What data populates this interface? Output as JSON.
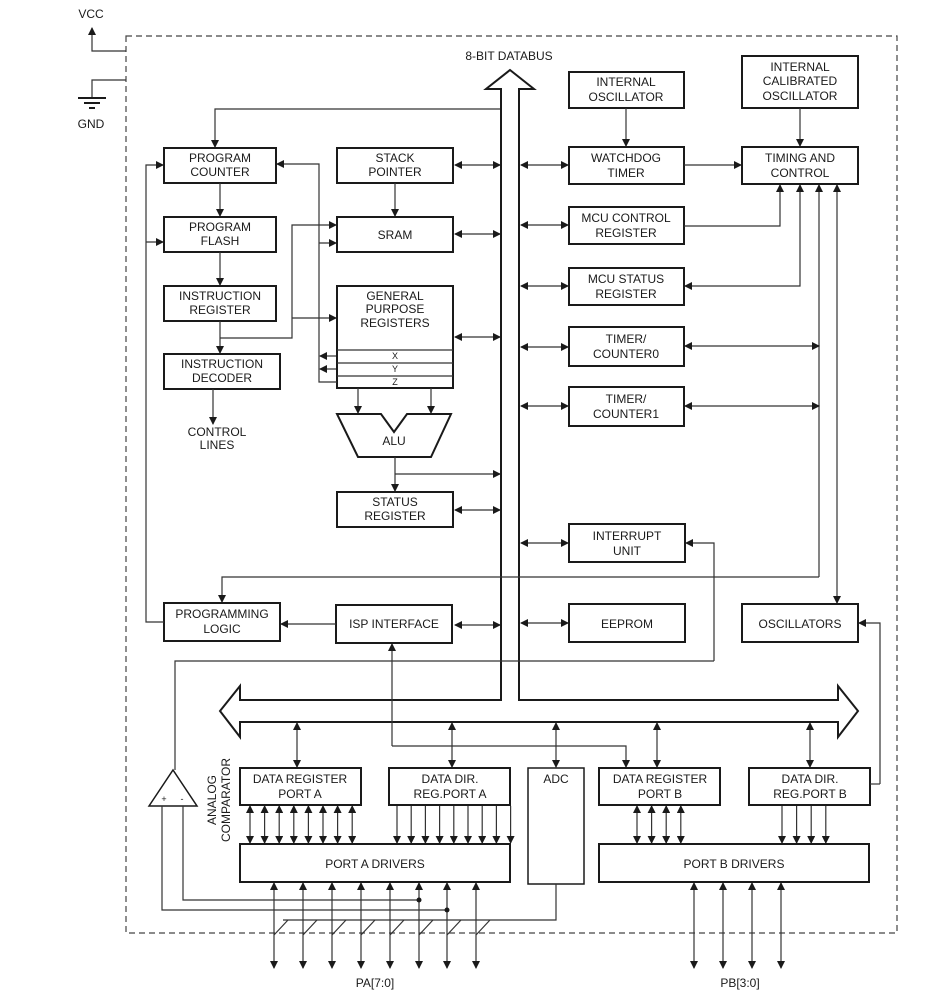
{
  "power": {
    "vcc": "VCC",
    "gnd": "GND"
  },
  "databus": {
    "label": "8-BIT DATABUS"
  },
  "blocks": {
    "program_counter": [
      "PROGRAM",
      "COUNTER"
    ],
    "program_flash": [
      "PROGRAM",
      "FLASH"
    ],
    "instruction_register": [
      "INSTRUCTION",
      "REGISTER"
    ],
    "instruction_decoder": [
      "INSTRUCTION",
      "DECODER"
    ],
    "control_lines": [
      "CONTROL",
      "LINES"
    ],
    "stack_pointer": [
      "STACK",
      "POINTER"
    ],
    "sram": [
      "SRAM"
    ],
    "gpr": [
      "GENERAL",
      "PURPOSE",
      "REGISTERS"
    ],
    "gpr_x": "X",
    "gpr_y": "Y",
    "gpr_z": "Z",
    "alu": "ALU",
    "status_register": [
      "STATUS",
      "REGISTER"
    ],
    "programming_logic": [
      "PROGRAMMING",
      "LOGIC"
    ],
    "isp_interface": [
      "ISP INTERFACE"
    ],
    "internal_oscillator": [
      "INTERNAL",
      "OSCILLATOR"
    ],
    "internal_calibrated_oscillator": [
      "INTERNAL",
      "CALIBRATED",
      "OSCILLATOR"
    ],
    "watchdog_timer": [
      "WATCHDOG",
      "TIMER"
    ],
    "timing_control": [
      "TIMING AND",
      "CONTROL"
    ],
    "mcu_control_register": [
      "MCU CONTROL",
      "REGISTER"
    ],
    "mcu_status_register": [
      "MCU STATUS",
      "REGISTER"
    ],
    "timer_counter0": [
      "TIMER/",
      "COUNTER0"
    ],
    "timer_counter1": [
      "TIMER/",
      "COUNTER1"
    ],
    "interrupt_unit": [
      "INTERRUPT",
      "UNIT"
    ],
    "eeprom": [
      "EEPROM"
    ],
    "oscillators": [
      "OSCILLATORS"
    ],
    "analog_comparator": [
      "ANALOG",
      "COMPARATOR"
    ],
    "comparator_plus": "+",
    "comparator_minus": "-",
    "data_register_port_a": [
      "DATA REGISTER",
      "PORT A"
    ],
    "data_dir_reg_port_a": [
      "DATA DIR.",
      "REG.PORT A"
    ],
    "adc": [
      "ADC"
    ],
    "data_register_port_b": [
      "DATA REGISTER",
      "PORT B"
    ],
    "data_dir_reg_port_b": [
      "DATA DIR.",
      "REG.PORT B"
    ],
    "port_a_drivers": [
      "PORT A DRIVERS"
    ],
    "port_b_drivers": [
      "PORT B DRIVERS"
    ]
  },
  "pins": {
    "port_a": "PA[7:0]",
    "port_b": "PB[3:0]"
  }
}
